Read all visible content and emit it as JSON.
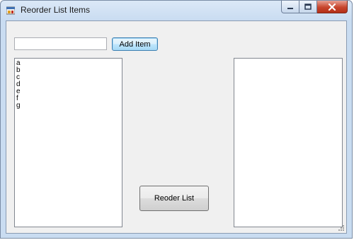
{
  "window": {
    "title": "Reorder List Items",
    "icon": "form-app-icon",
    "controls": {
      "minimize_icon": "minimize-icon",
      "maximize_icon": "restore-icon",
      "close_icon": "close-icon"
    }
  },
  "form": {
    "input": {
      "value": "",
      "placeholder": ""
    },
    "add_button_label": "Add Item",
    "reorder_button_label": "Reoder List",
    "source_list": {
      "items": [
        "a",
        "b",
        "c",
        "d",
        "e",
        "f",
        "g"
      ]
    },
    "target_list": {
      "items": []
    }
  },
  "colors": {
    "close_button": "#c7452d",
    "focused_button_border": "#3c7fb1",
    "client_background": "#f0f0f0"
  }
}
